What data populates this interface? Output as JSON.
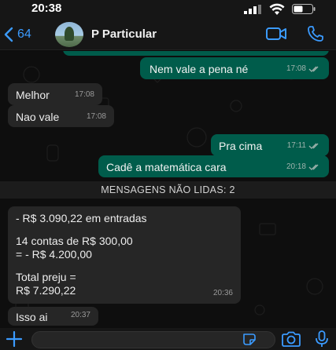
{
  "status_bar": {
    "time": "20:38"
  },
  "header": {
    "back_count": "64",
    "contact_name": "P Particular",
    "icons": [
      "chevron-left-icon",
      "video-call-icon",
      "phone-icon"
    ]
  },
  "messages": [
    {
      "direction": "out",
      "text": "Nem vale a pena né",
      "time": "17:08",
      "status": "read"
    },
    {
      "direction": "in",
      "text": "Melhor",
      "time": "17:08"
    },
    {
      "direction": "in",
      "text": "Nao vale",
      "time": "17:08"
    },
    {
      "direction": "out",
      "text": "Pra cima",
      "time": "17:11",
      "status": "read"
    },
    {
      "direction": "out",
      "text": "Cadê a matemática cara",
      "time": "20:18",
      "status": "read"
    }
  ],
  "unread_divider": "MENSAGENS NÃO LIDAS: 2",
  "unread_messages": [
    {
      "direction": "in",
      "lines": [
        "- R$ 3.090,22 em entradas",
        "",
        "14 contas de R$ 300,00",
        "= - R$ 4.200,00",
        "",
        "Total preju =",
        "R$ 7.290,22"
      ],
      "time": "20:36"
    },
    {
      "direction": "in",
      "text": "Isso ai",
      "time": "20:37"
    }
  ],
  "input_bar": {
    "icons": [
      "plus-icon",
      "sticker-icon",
      "camera-icon",
      "microphone-icon"
    ]
  },
  "colors": {
    "outgoing_bubble": "#005c4b",
    "incoming_bubble": "#262626",
    "accent": "#3b9bff",
    "background": "#0e0e0e"
  }
}
